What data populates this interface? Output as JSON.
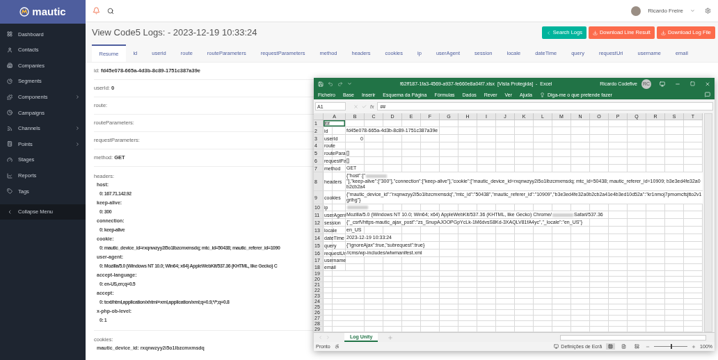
{
  "brand": {
    "name": "mautic"
  },
  "sidebar": {
    "items": [
      {
        "label": "Dashboard",
        "has_submenu": false
      },
      {
        "label": "Contacts",
        "has_submenu": false
      },
      {
        "label": "Companies",
        "has_submenu": false
      },
      {
        "label": "Segments",
        "has_submenu": false
      },
      {
        "label": "Components",
        "has_submenu": true
      },
      {
        "label": "Campaigns",
        "has_submenu": false
      },
      {
        "label": "Channels",
        "has_submenu": true
      },
      {
        "label": "Points",
        "has_submenu": true
      },
      {
        "label": "Stages",
        "has_submenu": false
      },
      {
        "label": "Reports",
        "has_submenu": false
      },
      {
        "label": "Tags",
        "has_submenu": false
      }
    ],
    "collapse": {
      "label": "Collapse Menu"
    }
  },
  "topbar": {
    "user": "Ricardo Freire"
  },
  "page": {
    "title": "View Code5 Logs: - 2023-12-19 10:33:24",
    "buttons": [
      {
        "label": "Search Logs",
        "kind": "back"
      },
      {
        "label": "Download Line Result",
        "kind": "download"
      },
      {
        "label": "Download Log File",
        "kind": "download"
      }
    ],
    "tabs": [
      {
        "label": "Resume",
        "selected": true
      },
      {
        "label": "id",
        "selected": false
      },
      {
        "label": "userid",
        "selected": false
      },
      {
        "label": "route",
        "selected": false
      },
      {
        "label": "routeParameters",
        "selected": false
      },
      {
        "label": "requestParameters",
        "selected": false
      },
      {
        "label": "method",
        "selected": false
      },
      {
        "label": "headers",
        "selected": false
      },
      {
        "label": "cookies",
        "selected": false
      },
      {
        "label": "ip",
        "selected": false
      },
      {
        "label": "userAgent",
        "selected": false
      },
      {
        "label": "session",
        "selected": false
      },
      {
        "label": "locale",
        "selected": false
      },
      {
        "label": "dateTime",
        "selected": false
      },
      {
        "label": "query",
        "selected": false
      },
      {
        "label": "requestUri",
        "selected": false
      },
      {
        "label": "username",
        "selected": false
      },
      {
        "label": "email",
        "selected": false
      }
    ],
    "fields": [
      {
        "label": "id:",
        "value": "fd45e078-665a-4d3b-8c89-1751c387a39e"
      },
      {
        "label": "userId:",
        "value": "0"
      },
      {
        "label": "route:"
      },
      {
        "label": "routeParameters:"
      },
      {
        "label": "requestParameters:"
      },
      {
        "label": "method:",
        "value": "GET"
      }
    ],
    "headers": {
      "label": "headers:",
      "entries": [
        {
          "name": "host:",
          "values": [
            "0: 167.71.142.92"
          ]
        },
        {
          "name": "keep-alive:",
          "values": [
            "0: 300"
          ]
        },
        {
          "name": "connection:",
          "values": [
            "0: keep-alive"
          ]
        },
        {
          "name": "cookie:",
          "values": [
            "0: mautic_device_id=rxqnwzyy2i5o1lbzcmxmsdq; mtc_id=50438; mautic_referer_id=1090"
          ]
        },
        {
          "name": "user-agent:",
          "values": [
            "0: Mozilla/5.0 (Windows NT 10.0; Win64; x64) AppleWebKit/537.36 (KHTML, like Gecko) C"
          ]
        },
        {
          "name": "accept-language:",
          "values": [
            "0: en-US,en;q=0.5"
          ]
        },
        {
          "name": "accept:",
          "values": [
            "0: text/html,application/xhtml+xml,application/xml;q=0.9,*/*;q=0.8"
          ]
        },
        {
          "name": "x-php-ob-level:",
          "values": [
            "0: 1"
          ]
        }
      ]
    },
    "cookies": {
      "label": "cookies:",
      "entries": [
        "mautic_device_id: rxqnwzyy2i5o1lbzcmxmsdq"
      ]
    }
  },
  "excel": {
    "title": "f62ff187-1fa3-4569-a937-fe660e8a04f7.xlsx  [Vista Protegida]  -  Excel",
    "account": "Ricardo Codefive",
    "account_initials": "RC",
    "ribbon_tabs": [
      "Ficheiro",
      "Base",
      "Inserir",
      "Esquema da Página",
      "Fórmulas",
      "Dados",
      "Rever",
      "Ver",
      "Ajuda"
    ],
    "tell_me": "Diga-me o que pretende fazer",
    "name_box": "A1",
    "formula_label": "fx",
    "formula": "##",
    "columns": [
      "A",
      "B",
      "C",
      "D",
      "E",
      "F",
      "G",
      "H",
      "I",
      "J",
      "K",
      "L",
      "M",
      "N",
      "O",
      "P",
      "Q",
      "R",
      "S",
      "T"
    ],
    "rows": [
      {
        "num": "1",
        "col_a": "##",
        "selected": true
      },
      {
        "num": "2",
        "col_a": "id",
        "col_b": [
          {
            "kind": "text",
            "text": "fd45e078-665a-4d3b-8c89-1751c387a39e"
          }
        ],
        "selected": false
      },
      {
        "num": "3",
        "col_a": "userId",
        "col_b": [
          {
            "kind": "number",
            "text": "0"
          }
        ],
        "selected": false
      },
      {
        "num": "4",
        "col_a": "route",
        "selected": false
      },
      {
        "num": "5",
        "col_a": "routePara",
        "col_b": [
          {
            "kind": "text",
            "text": "[]"
          }
        ],
        "selected": false
      },
      {
        "num": "6",
        "col_a": "requestPa",
        "col_b": [
          {
            "kind": "text",
            "text": "[]"
          }
        ],
        "selected": false
      },
      {
        "num": "7",
        "col_a": "method",
        "col_b": [
          {
            "kind": "text",
            "text": "GET"
          }
        ],
        "selected": false
      },
      {
        "num": "8",
        "col_a": "headers",
        "col_b": [
          {
            "kind": "text",
            "text": "{\"host\":[\""
          },
          {
            "kind": "redacted"
          },
          {
            "kind": "text",
            "text": "\"],\"keep-alive\":[\"300\"],\"connection\":[\"keep-alive\"],\"cookie\":[\"mautic_device_id=rxqnwzyy2i5o1lbzcmxmsdq; mtc_id=50438; mautic_referer_id=10909; b3e3ed4fe32a0b2cb2a4"
          }
        ],
        "selected": false
      },
      {
        "num": "9",
        "col_a": "cookies",
        "col_b": [
          {
            "kind": "text",
            "text": "{\"mautic_device_id\":\"rxqnwzyy2i5o1lbzcmxmsdq\",\"mtc_id\":\"50438\",\"mautic_referer_id\":\"10909\",\"b3e3ed4fe32a0b2cb2a41e4b3ed10d52a\":\"kr1nmoj7pmomcfsjtto2v1grihg\"}"
          }
        ],
        "selected": false
      },
      {
        "num": "10",
        "col_a": "ip",
        "col_b": [
          {
            "kind": "redacted"
          }
        ],
        "selected": false
      },
      {
        "num": "11",
        "col_a": "userAgent",
        "col_b": [
          {
            "kind": "text",
            "text": "Mozilla/5.0 (Windows NT 10.0; Win64; x64) AppleWebKit/537.36 (KHTML, like Gecko) Chrome/"
          },
          {
            "kind": "redacted"
          },
          {
            "kind": "text",
            "text": "Safari/537.36"
          }
        ],
        "selected": false
      },
      {
        "num": "12",
        "col_a": "session",
        "col_b": [
          {
            "kind": "text",
            "text": "{\"_csrf\\/https-mautic_ajax_post\":\"zs_SnupAJOOPGpYcLk-1M6dvsS8Kd-3XAQLV81fA4yc\",\"_locale\":\"en_US\"}"
          }
        ],
        "selected": false
      },
      {
        "num": "13",
        "col_a": "locale",
        "col_b": [
          {
            "kind": "text",
            "text": "en_US"
          }
        ],
        "selected": false
      },
      {
        "num": "14",
        "col_a": "dateTime",
        "col_b": [
          {
            "kind": "text",
            "text": "2023-12-19 10:33:24"
          }
        ],
        "selected": false
      },
      {
        "num": "15",
        "col_a": "query",
        "col_b": [
          {
            "kind": "text",
            "text": "{\"ignoreAjax\":true,\"subrequest\":true}"
          }
        ],
        "selected": false
      },
      {
        "num": "16",
        "col_a": "requestUr",
        "col_b": [
          {
            "kind": "text",
            "text": "//cms/wp-includes/wlwmanifest.xml"
          }
        ],
        "selected": false
      },
      {
        "num": "17",
        "col_a": "username",
        "selected": false
      },
      {
        "num": "18",
        "col_a": "email",
        "selected": false
      },
      {
        "num": "19",
        "selected": false
      },
      {
        "num": "20",
        "selected": false
      },
      {
        "num": "21",
        "selected": false
      },
      {
        "num": "22",
        "selected": false
      },
      {
        "num": "23",
        "selected": false
      },
      {
        "num": "24",
        "selected": false
      },
      {
        "num": "25",
        "selected": false
      },
      {
        "num": "26",
        "selected": false
      },
      {
        "num": "27",
        "selected": false
      },
      {
        "num": "28",
        "selected": false
      },
      {
        "num": "29",
        "selected": false
      }
    ],
    "sheets": [
      {
        "label": "Log Unity",
        "selected": true
      }
    ],
    "status": "Pronto",
    "display_settings": "Definições de Ecrã",
    "views": [
      {
        "selected": true
      },
      {
        "selected": false
      },
      {
        "selected": false
      }
    ],
    "zoom": {
      "level": 0.5,
      "reading": "100%"
    }
  }
}
